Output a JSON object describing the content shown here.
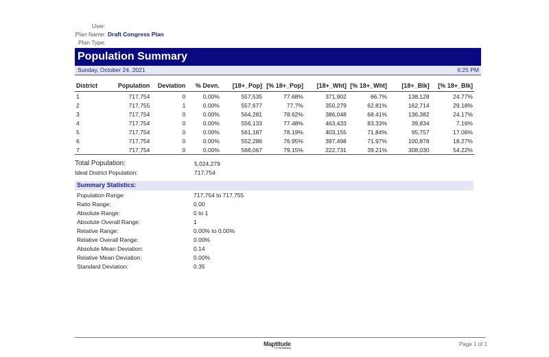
{
  "meta": {
    "user_label": "User:",
    "user_value": "",
    "plan_name_label": "Plan Name:",
    "plan_name_value": "Draft Congress Plan",
    "plan_type_label": "Plan Type:",
    "plan_type_value": ""
  },
  "report": {
    "title": "Population Summary",
    "date": "Sunday, October 24, 2021",
    "time": "6:25 PM"
  },
  "table": {
    "headers": [
      "District",
      "Population",
      "Deviation",
      "% Devn.",
      "[18+_Pop]",
      "[% 18+_Pop]",
      "[18+_Wht]",
      "[% 18+_Wht]",
      "[18+_Blk]",
      "[% 18+_Blk]"
    ],
    "rows": [
      [
        "1",
        "717,754",
        "0",
        "0.00%",
        "557,535",
        "77.68%",
        "371,902",
        "66.7%",
        "138,128",
        "24.77%"
      ],
      [
        "2",
        "717,755",
        "1",
        "0.00%",
        "557,677",
        "77.7%",
        "350,279",
        "62.81%",
        "162,714",
        "29.18%"
      ],
      [
        "3",
        "717,754",
        "0",
        "0.00%",
        "564,281",
        "78.62%",
        "386,048",
        "68.41%",
        "136,382",
        "24.17%"
      ],
      [
        "4",
        "717,754",
        "0",
        "0.00%",
        "556,133",
        "77.48%",
        "463,433",
        "83.33%",
        "39,834",
        "7.16%"
      ],
      [
        "5",
        "717,754",
        "0",
        "0.00%",
        "561,187",
        "78.19%",
        "403,155",
        "71.84%",
        "95,757",
        "17.06%"
      ],
      [
        "6",
        "717,754",
        "0",
        "0.00%",
        "552,286",
        "76.95%",
        "397,498",
        "71.97%",
        "100,878",
        "18.27%"
      ],
      [
        "7",
        "717,754",
        "0",
        "0.00%",
        "568,067",
        "79.15%",
        "222,731",
        "39.21%",
        "308,030",
        "54.22%"
      ]
    ]
  },
  "totals": {
    "total_population_label": "Total Population:",
    "total_population_value": "5,024,279",
    "ideal_label": "Ideal District Population:",
    "ideal_value": "717,754"
  },
  "summary": {
    "heading": "Summary Statistics:",
    "items": [
      {
        "label": "Population Range:",
        "value": "717,754 to 717,755"
      },
      {
        "label": "Ratio Range:",
        "value": "0.00"
      },
      {
        "label": "Absolute Range:",
        "value": "0 to 1"
      },
      {
        "label": "Absolute Overall Range:",
        "value": "1"
      },
      {
        "label": "Relative Range:",
        "value": "0.00% to 0.00%"
      },
      {
        "label": "Relative Overall Range:",
        "value": "0.00%"
      },
      {
        "label": "Absolute Mean Deviation:",
        "value": "0.14"
      },
      {
        "label": "Relative Mean Deviation:",
        "value": "0.00%"
      },
      {
        "label": "Standard Deviation:",
        "value": "0.35"
      }
    ]
  },
  "footer": {
    "logo": "Maptitude",
    "logo_sub": "For Redistricting",
    "page": "Page 1 of 1"
  }
}
